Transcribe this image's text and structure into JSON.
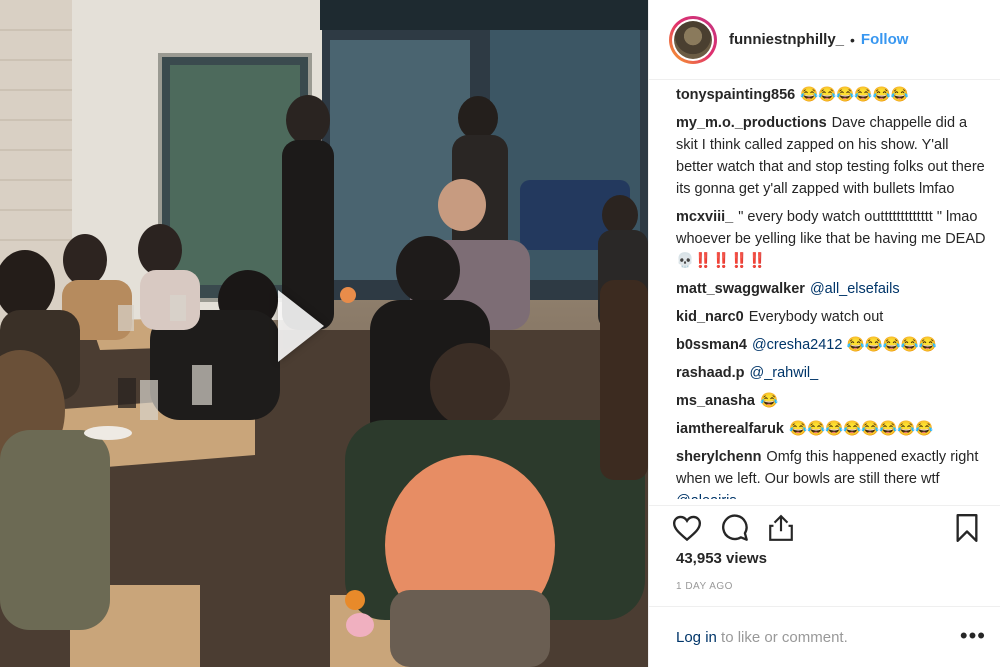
{
  "profile": {
    "username": "funniestnphilly_",
    "separator": "•",
    "follow_label": "Follow"
  },
  "video": {
    "play_icon": "play-icon"
  },
  "comments": [
    {
      "user": "tonyspainting856",
      "parts": [
        {
          "text": "😂😂😂😂😂😂",
          "mention": false
        }
      ]
    },
    {
      "user": "my_m.o._productions",
      "parts": [
        {
          "text": "Dave chappelle did a skit I think called zapped on his show. Y'all better watch that and stop testing folks out there its gonna get y'all zapped with bullets lmfao",
          "mention": false
        }
      ]
    },
    {
      "user": "mcxviii_",
      "parts": [
        {
          "text": "\" every body watch outtttttttttttt \" lmao whoever be yelling like that be having me DEAD 💀‼️‼️‼️‼️",
          "mention": false
        }
      ]
    },
    {
      "user": "matt_swaggwalker",
      "parts": [
        {
          "text": "@all_elsefails",
          "mention": true
        }
      ]
    },
    {
      "user": "kid_narc0",
      "parts": [
        {
          "text": "Everybody watch out",
          "mention": false
        }
      ]
    },
    {
      "user": "b0ssman4",
      "parts": [
        {
          "text": "@cresha2412",
          "mention": true
        },
        {
          "text": " 😂😂😂😂😂",
          "mention": false
        }
      ]
    },
    {
      "user": "rashaad.p",
      "parts": [
        {
          "text": "@_rahwil_",
          "mention": true
        }
      ]
    },
    {
      "user": "ms_anasha",
      "parts": [
        {
          "text": "😂",
          "mention": false
        }
      ]
    },
    {
      "user": "iamtherealfaruk",
      "parts": [
        {
          "text": "😂😂😂😂😂😂😂😂",
          "mention": false
        }
      ]
    },
    {
      "user": "sherylchenn",
      "parts": [
        {
          "text": "Omfg this happened exactly right when we left. Our bowls are still there wtf ",
          "mention": false
        },
        {
          "text": "@aleairis",
          "mention": true
        }
      ]
    }
  ],
  "actions": {
    "like": "heart-icon",
    "comment": "comment-icon",
    "share": "share-icon",
    "save": "bookmark-icon"
  },
  "stats": {
    "views": "43,953 views",
    "time_ago": "1 DAY AGO"
  },
  "footer": {
    "login_link": "Log in",
    "login_text": " to like or comment.",
    "more": "•••"
  },
  "colors": {
    "link": "#3897f0",
    "mention": "#003569",
    "text": "#262626",
    "muted": "#999999"
  }
}
